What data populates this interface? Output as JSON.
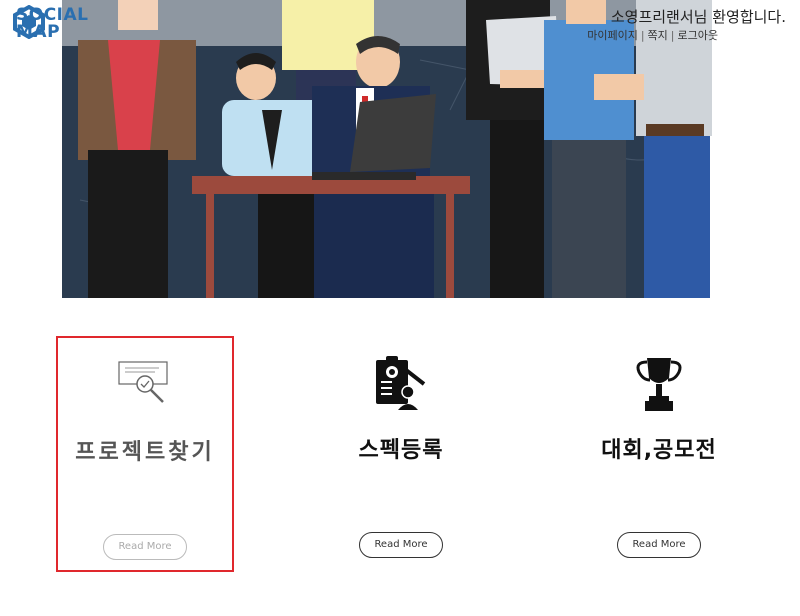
{
  "header": {
    "logo_line1": "SOCIAL",
    "logo_line2": "MAP",
    "welcome_text": "소영프리랜서님 환영합니다.",
    "menu": [
      "마이페이지",
      "쪽지",
      "로그아웃"
    ],
    "menu_separator": "|"
  },
  "features": [
    {
      "title": "프로젝트찾기",
      "button": "Read More",
      "icon": "search-document-icon",
      "selected": true
    },
    {
      "title": "스펙등록",
      "button": "Read More",
      "icon": "spec-document-icon",
      "selected": false
    },
    {
      "title": "대회,공모전",
      "button": "Read More",
      "icon": "trophy-icon",
      "selected": false
    }
  ],
  "colors": {
    "brand": "#2a6fb0",
    "selection_border": "#e0282d",
    "chalkboard": "#26374a",
    "desk": "#a24a3e"
  }
}
